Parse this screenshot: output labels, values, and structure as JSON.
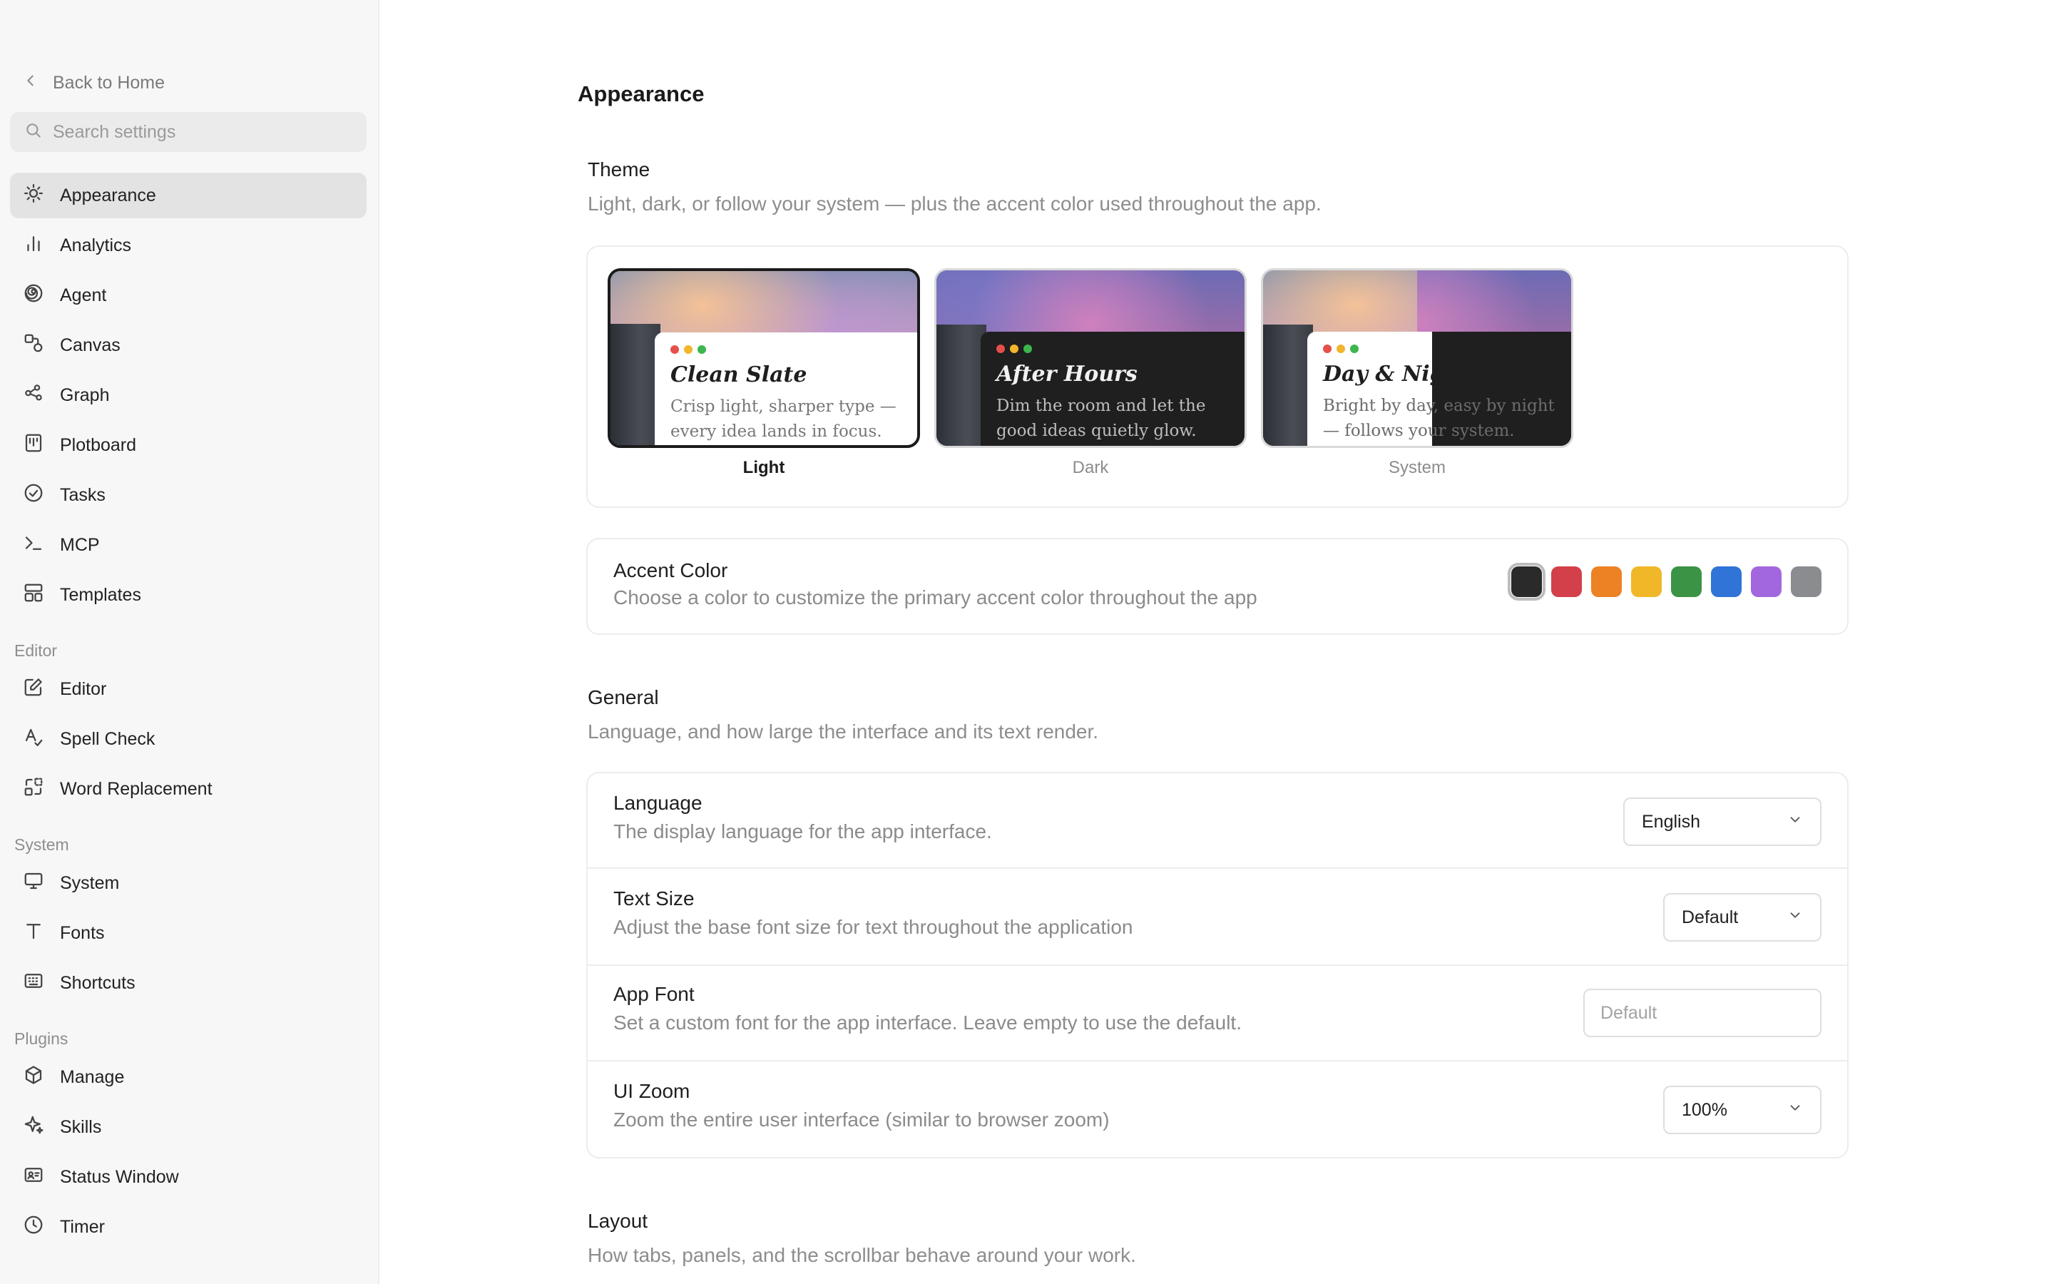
{
  "sidebar": {
    "back_label": "Back to Home",
    "search_placeholder": "Search settings",
    "items": [
      {
        "label": "Appearance"
      },
      {
        "label": "Analytics"
      },
      {
        "label": "Agent"
      },
      {
        "label": "Canvas"
      },
      {
        "label": "Graph"
      },
      {
        "label": "Plotboard"
      },
      {
        "label": "Tasks"
      },
      {
        "label": "MCP"
      },
      {
        "label": "Templates"
      }
    ],
    "editor_section": "Editor",
    "editor_items": [
      {
        "label": "Editor"
      },
      {
        "label": "Spell Check"
      },
      {
        "label": "Word Replacement"
      }
    ],
    "system_section": "System",
    "system_items": [
      {
        "label": "System"
      },
      {
        "label": "Fonts"
      },
      {
        "label": "Shortcuts"
      }
    ],
    "plugins_section": "Plugins",
    "plugins_items": [
      {
        "label": "Manage"
      },
      {
        "label": "Skills"
      },
      {
        "label": "Status Window"
      },
      {
        "label": "Timer"
      }
    ]
  },
  "main": {
    "page_title": "Appearance",
    "theme": {
      "title": "Theme",
      "description": "Light, dark, or follow your system — plus the accent color used throughout the app.",
      "options": [
        {
          "name": "Clean Slate",
          "body": "Crisp light, sharper type — every idea lands in focus.",
          "label": "Light",
          "selected": true
        },
        {
          "name": "After Hours",
          "body": "Dim the room and let the good ideas quietly glow.",
          "label": "Dark",
          "selected": false
        },
        {
          "name": "Day & Night",
          "body": "Bright by day, easy by night — follows your system.",
          "label": "System",
          "selected": false
        }
      ]
    },
    "accent": {
      "title": "Accent Color",
      "description": "Choose a color to customize the primary accent color throughout the app",
      "colors": [
        "#2a2a2a",
        "#d3404a",
        "#ec8224",
        "#f0b729",
        "#3b9345",
        "#2f74d6",
        "#a267de",
        "#8a8c90"
      ],
      "selected_index": 0
    },
    "general": {
      "title": "General",
      "description": "Language, and how large the interface and its text render.",
      "language": {
        "title": "Language",
        "description": "The display language for the app interface.",
        "value": "English"
      },
      "text_size": {
        "title": "Text Size",
        "description": "Adjust the base font size for text throughout the application",
        "value": "Default"
      },
      "app_font": {
        "title": "App Font",
        "description": "Set a custom font for the app interface. Leave empty to use the default.",
        "placeholder": "Default"
      },
      "ui_zoom": {
        "title": "UI Zoom",
        "description": "Zoom the entire user interface (similar to browser zoom)",
        "value": "100%"
      }
    },
    "layout": {
      "title": "Layout",
      "description": "How tabs, panels, and the scrollbar behave around your work."
    }
  }
}
